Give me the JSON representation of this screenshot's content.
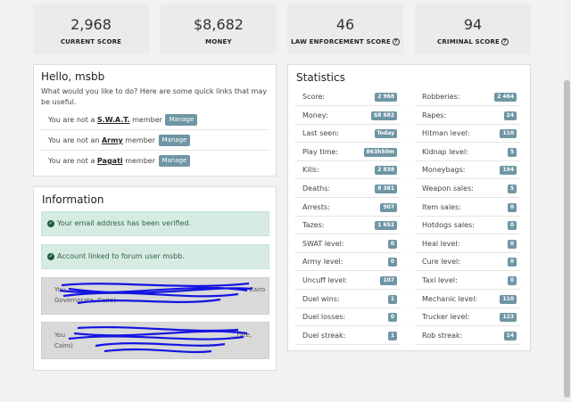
{
  "top_stats": [
    {
      "value": "2,968",
      "label": "CURRENT SCORE",
      "info": false
    },
    {
      "value": "$8,682",
      "label": "MONEY",
      "info": false
    },
    {
      "value": "46",
      "label": "LAW ENFORCEMENT SCORE",
      "info": true
    },
    {
      "value": "94",
      "label": "CRIMINAL SCORE",
      "info": true
    }
  ],
  "hello": {
    "title": "Hello, msbb",
    "subtitle": "What would you like to do? Here are some quick links that may be useful.",
    "manage_label": "Manage",
    "rows": [
      {
        "prefix": "You are not a ",
        "group": "S.W.A.T.",
        "suffix": " member"
      },
      {
        "prefix": "You are not an ",
        "group": "Army",
        "suffix": " member"
      },
      {
        "prefix": "You are not a ",
        "group": "Pagati",
        "suffix": " member"
      }
    ]
  },
  "information": {
    "title": "Information",
    "alerts": [
      "Your email address has been verified.",
      "Account linked to forum user msbb."
    ],
    "redacted": [
      {
        "line1": "You",
        "line1_end": "Cairo",
        "line2": "Governorate, Cairo)"
      },
      {
        "line1": "You",
        "line1_end": "...rate,",
        "line2": "Cairo)"
      }
    ]
  },
  "statistics": {
    "title": "Statistics",
    "left": [
      {
        "label": "Score:",
        "value": "2 968"
      },
      {
        "label": "Money:",
        "value": "$8 682"
      },
      {
        "label": "Last seen:",
        "value": "Today"
      },
      {
        "label": "Play time:",
        "value": "863h50m"
      },
      {
        "label": "Kills:",
        "value": "2 838"
      },
      {
        "label": "Deaths:",
        "value": "8 381"
      },
      {
        "label": "Arrests:",
        "value": "907"
      },
      {
        "label": "Tazes:",
        "value": "1 652"
      },
      {
        "label": "SWAT level:",
        "value": "0"
      },
      {
        "label": "Army level:",
        "value": "0"
      },
      {
        "label": "Uncuff level:",
        "value": "107"
      },
      {
        "label": "Duel wins:",
        "value": "1"
      },
      {
        "label": "Duel losses:",
        "value": "0"
      },
      {
        "label": "Duel streak:",
        "value": "1"
      }
    ],
    "right": [
      {
        "label": "Robberies:",
        "value": "2 464"
      },
      {
        "label": "Rapes:",
        "value": "24"
      },
      {
        "label": "Hitman level:",
        "value": "110"
      },
      {
        "label": "Kidnap level:",
        "value": "5"
      },
      {
        "label": "Moneybags:",
        "value": "194"
      },
      {
        "label": "Weapon sales:",
        "value": "5"
      },
      {
        "label": "Item sales:",
        "value": "0"
      },
      {
        "label": "Hotdogs sales:",
        "value": "0"
      },
      {
        "label": "Heal level:",
        "value": "0"
      },
      {
        "label": "Cure level:",
        "value": "0"
      },
      {
        "label": "Taxi level:",
        "value": "0"
      },
      {
        "label": "Mechanic level:",
        "value": "110"
      },
      {
        "label": "Trucker level:",
        "value": "123"
      },
      {
        "label": "Rob streak:",
        "value": "14"
      }
    ]
  }
}
